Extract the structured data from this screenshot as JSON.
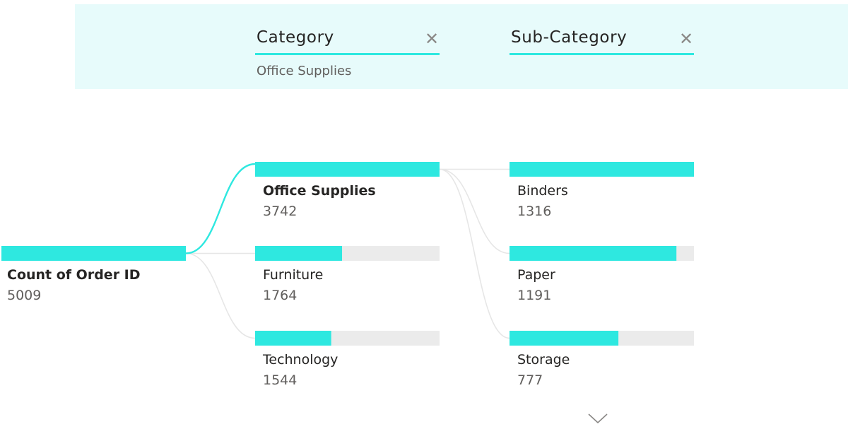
{
  "colors": {
    "accent": "#2ee8e0",
    "track": "#ebebeb",
    "link_muted": "#e6e6e6",
    "header_bg": "#e7fbfb",
    "value_text": "#605e5c",
    "label_text": "#252423"
  },
  "header": {
    "levels": [
      {
        "title": "Category",
        "close_icon": "close-icon",
        "selection": "Office Supplies"
      },
      {
        "title": "Sub-Category",
        "close_icon": "close-icon",
        "selection": ""
      }
    ]
  },
  "expand_icon": "chevron-down-icon",
  "chart_data": {
    "type": "decomposition-tree",
    "root": {
      "label": "Count of Order ID",
      "value": 5009
    },
    "levels": [
      {
        "name": "Category",
        "selected": "Office Supplies",
        "nodes": [
          {
            "label": "Office Supplies",
            "value": 3742
          },
          {
            "label": "Furniture",
            "value": 1764
          },
          {
            "label": "Technology",
            "value": 1544
          }
        ]
      },
      {
        "name": "Sub-Category",
        "parent": "Office Supplies",
        "nodes": [
          {
            "label": "Binders",
            "value": 1316
          },
          {
            "label": "Paper",
            "value": 1191
          },
          {
            "label": "Storage",
            "value": 777
          }
        ]
      }
    ]
  }
}
